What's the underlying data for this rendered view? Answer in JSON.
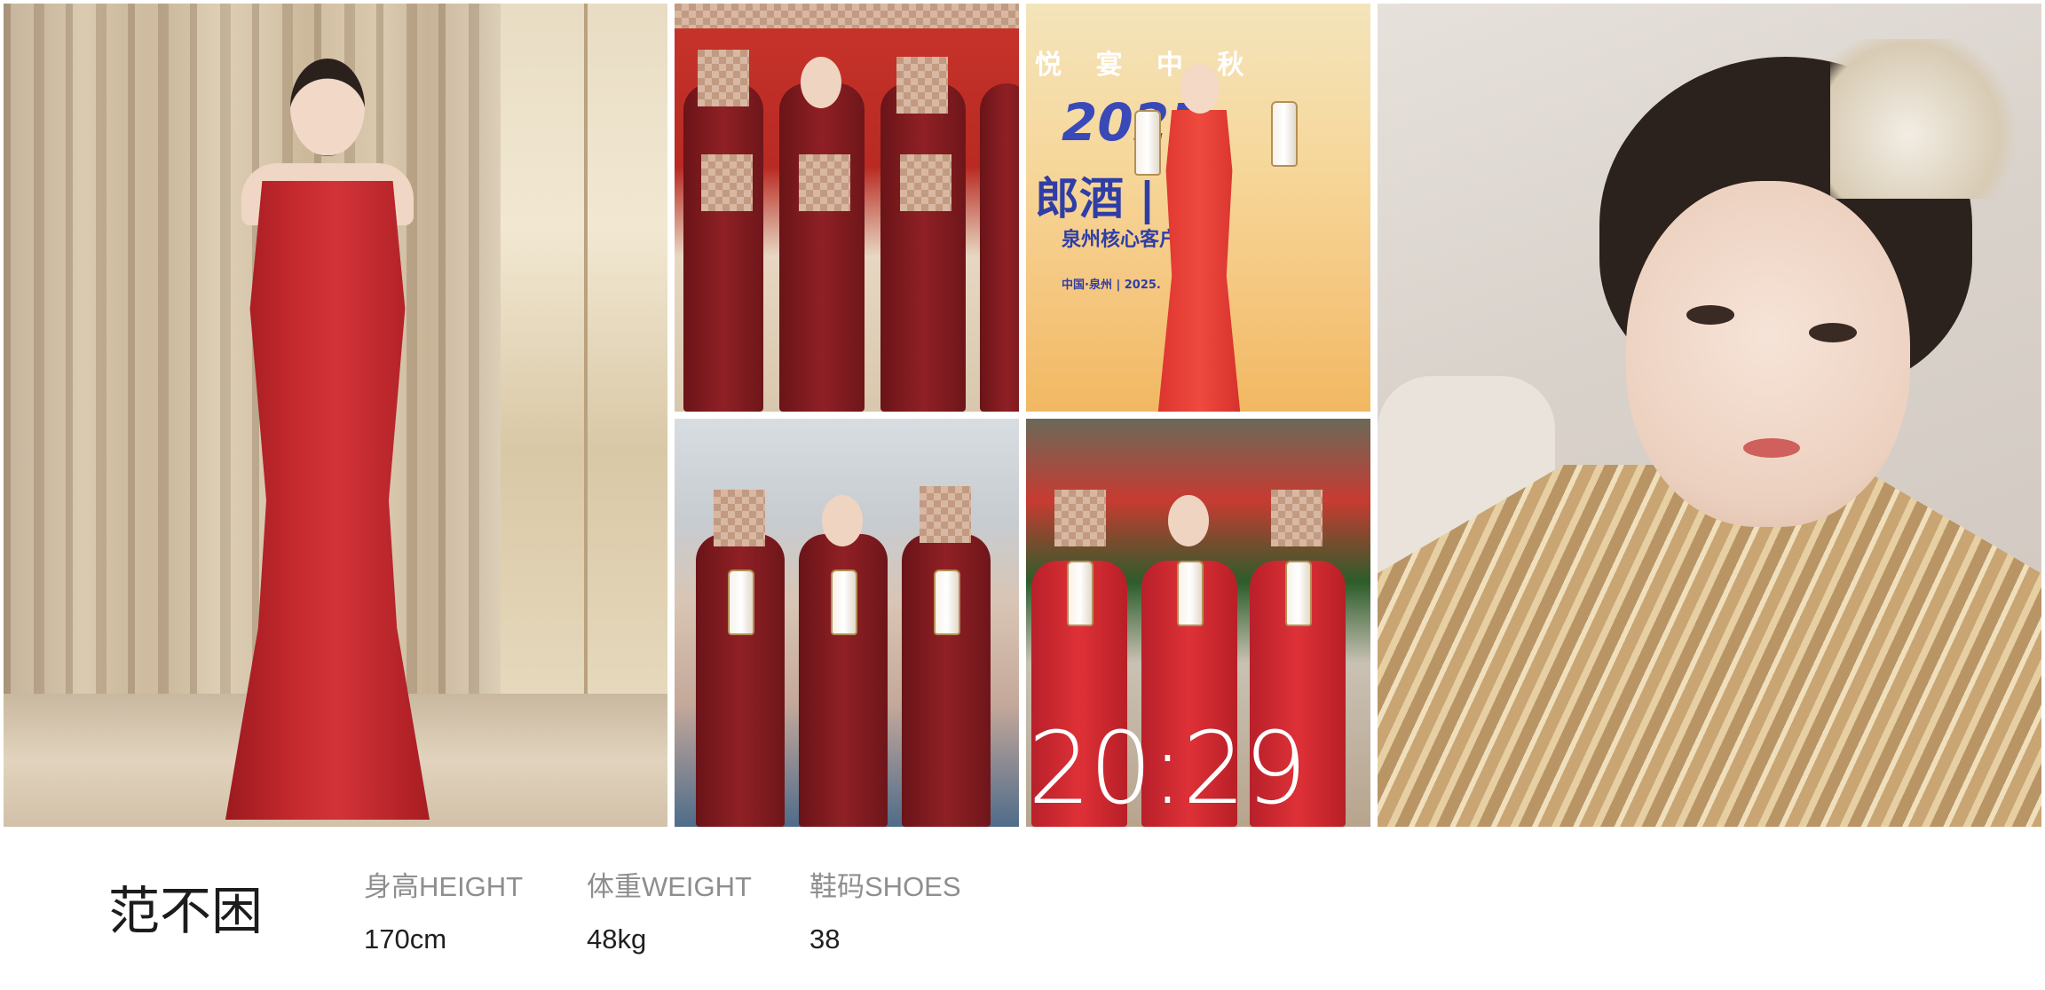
{
  "photos": [
    {
      "id": "full-length-portrait"
    },
    {
      "id": "group-bottle-presentation"
    },
    {
      "id": "event-banner-portrait",
      "banner": {
        "line1": "悦 宴 中 秋",
        "line2": "2025",
        "line3": "郎酒 | 郎",
        "line4": "泉州核心客户",
        "line5": "中国·泉州 | 2025."
      }
    },
    {
      "id": "banquet-hall-group"
    },
    {
      "id": "red-dress-group",
      "timestamp": "20:29"
    },
    {
      "id": "selfie-portrait"
    }
  ],
  "profile": {
    "name": "范不困",
    "stats": [
      {
        "label": "身高HEIGHT",
        "value": "170cm"
      },
      {
        "label": "体重WEIGHT",
        "value": "48kg"
      },
      {
        "label": "鞋码SHOES",
        "value": "38"
      }
    ]
  },
  "colors": {
    "background": "#ffffff",
    "label": "#8e8e8e",
    "value": "#1f1f1f",
    "name": "#1c1c1c"
  }
}
